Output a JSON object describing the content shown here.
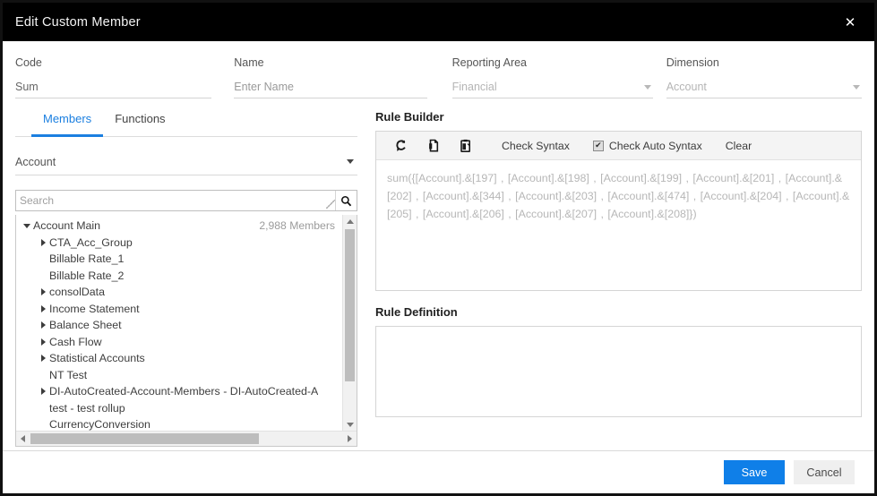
{
  "window": {
    "title": "Edit Custom Member",
    "close_label": "✕"
  },
  "form": {
    "code": {
      "label": "Code",
      "value": "Sum"
    },
    "name": {
      "label": "Name",
      "value": "",
      "placeholder": "Enter Name"
    },
    "reporting_area": {
      "label": "Reporting Area",
      "value": "Financial"
    },
    "dimension": {
      "label": "Dimension",
      "value": "Account"
    }
  },
  "left": {
    "tabs": [
      {
        "label": "Members",
        "active": true
      },
      {
        "label": "Functions",
        "active": false
      }
    ],
    "dimension_select": {
      "value": "Account"
    },
    "search": {
      "value": "",
      "placeholder": "Search"
    },
    "tree": [
      {
        "label": "Account Main",
        "indent": 0,
        "expander": "down",
        "count": "2,988 Members"
      },
      {
        "label": "CTA_Acc_Group",
        "indent": 1,
        "expander": "right",
        "count": ""
      },
      {
        "label": "Billable Rate_1",
        "indent": 1,
        "expander": "none",
        "count": ""
      },
      {
        "label": "Billable Rate_2",
        "indent": 1,
        "expander": "none",
        "count": ""
      },
      {
        "label": "consolData",
        "indent": 1,
        "expander": "right",
        "count": ""
      },
      {
        "label": "Income Statement",
        "indent": 1,
        "expander": "right",
        "count": ""
      },
      {
        "label": "Balance Sheet",
        "indent": 1,
        "expander": "right",
        "count": ""
      },
      {
        "label": "Cash Flow",
        "indent": 1,
        "expander": "right",
        "count": ""
      },
      {
        "label": "Statistical Accounts",
        "indent": 1,
        "expander": "right",
        "count": ""
      },
      {
        "label": "NT Test",
        "indent": 1,
        "expander": "none",
        "count": ""
      },
      {
        "label": "DI-AutoCreated-Account-Members - DI-AutoCreated-A",
        "indent": 1,
        "expander": "right",
        "count": ""
      },
      {
        "label": "test - test rollup",
        "indent": 1,
        "expander": "none",
        "count": ""
      },
      {
        "label": "CurrencyConversion",
        "indent": 1,
        "expander": "none",
        "count": ""
      }
    ]
  },
  "right": {
    "rule_builder": {
      "title": "Rule Builder",
      "toolbar": {
        "refresh_icon": "refresh-icon",
        "copy_icon": "copy-icon",
        "paste_icon": "paste-icon",
        "check_syntax": "Check Syntax",
        "check_auto_syntax": "Check Auto Syntax",
        "check_auto_syntax_checked": true,
        "checkmark": "✔",
        "clear": "Clear"
      },
      "expression": "sum({[Account].&[197] , [Account].&[198] , [Account].&[199] , [Account].&[201] , [Account].&[202] , [Account].&[344] , [Account].&[203] , [Account].&[474] , [Account].&[204] , [Account].&[205] , [Account].&[206] , [Account].&[207] , [Account].&[208]})"
    },
    "rule_definition": {
      "title": "Rule Definition",
      "value": ""
    }
  },
  "footer": {
    "save": "Save",
    "cancel": "Cancel"
  },
  "colors": {
    "accent": "#0f7fe8",
    "tab_active": "#1b7fe0",
    "titlebar": "#000000",
    "expression_text": "#b7b7b7"
  }
}
